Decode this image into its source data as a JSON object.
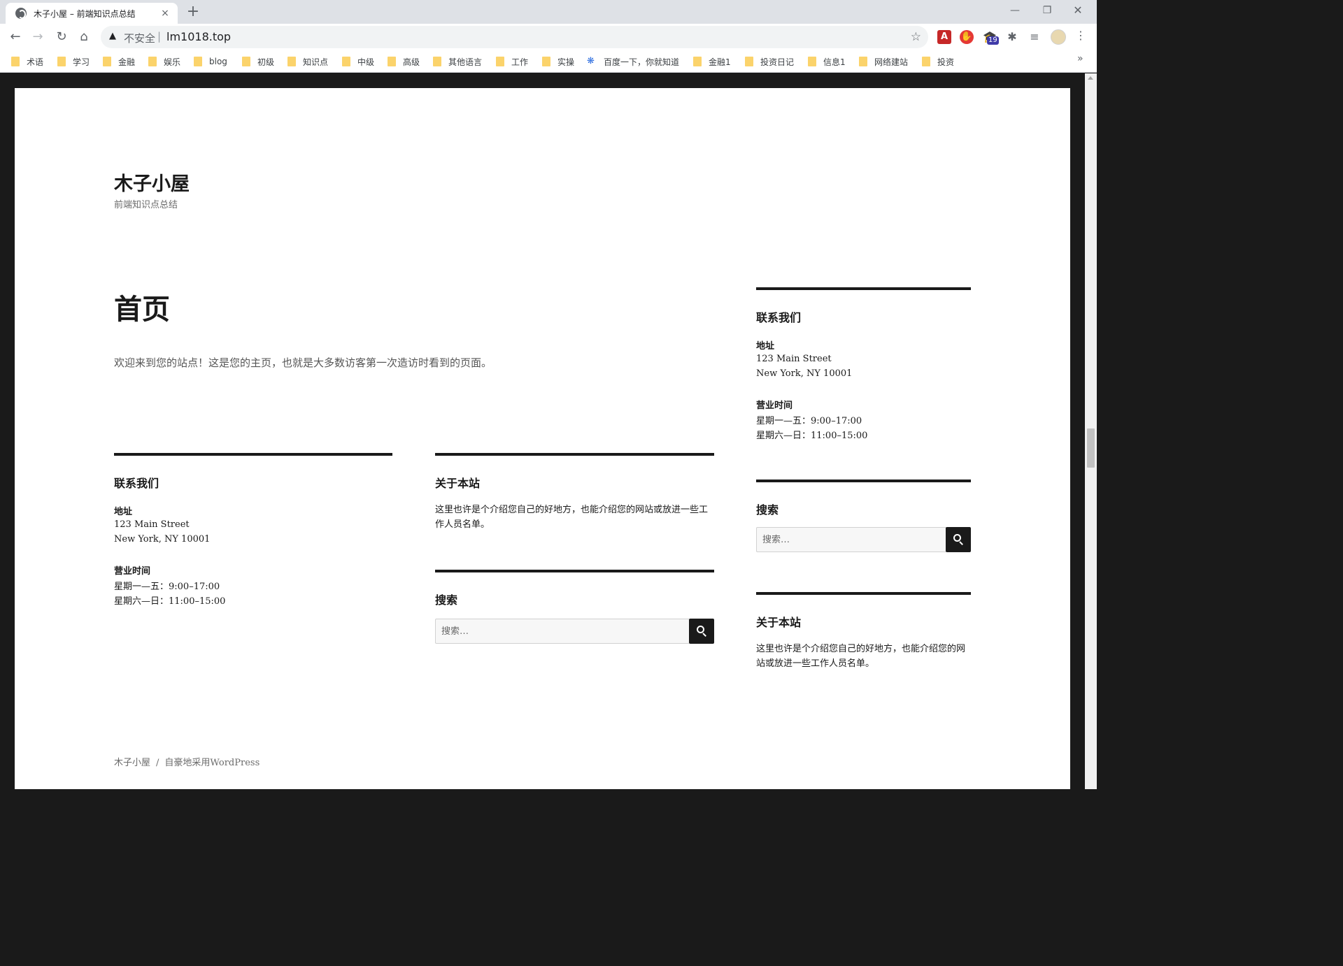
{
  "browser": {
    "tab_title": "木子小屋 – 前端知识点总结",
    "tab_close": "×",
    "new_tab": "+",
    "win_minimize": "—",
    "win_restore": "❐",
    "win_close": "✕",
    "nav": {
      "back": "←",
      "forward": "→",
      "reload": "↻",
      "home": "⌂"
    },
    "omnibox": {
      "warning_icon": "▲",
      "security_label": "不安全",
      "separator": "|",
      "url": "lm1018.top",
      "star": "☆"
    },
    "extensions": {
      "ext1": "A",
      "ext2": "✋",
      "ext3": "🎓",
      "ext3_badge": "19",
      "ext4": "✱",
      "ext5": "≡"
    },
    "menu": "⋮",
    "bookmarks": [
      {
        "label": "术语",
        "icon": "folder"
      },
      {
        "label": "学习",
        "icon": "folder"
      },
      {
        "label": "金融",
        "icon": "folder"
      },
      {
        "label": "娱乐",
        "icon": "folder"
      },
      {
        "label": "blog",
        "icon": "folder"
      },
      {
        "label": "初级",
        "icon": "folder"
      },
      {
        "label": "知识点",
        "icon": "folder"
      },
      {
        "label": "中级",
        "icon": "folder"
      },
      {
        "label": "高级",
        "icon": "folder"
      },
      {
        "label": "其他语言",
        "icon": "folder"
      },
      {
        "label": "工作",
        "icon": "folder"
      },
      {
        "label": "实操",
        "icon": "folder"
      },
      {
        "label": "百度一下，你就知道",
        "icon": "baidu-paw"
      },
      {
        "label": "金融1",
        "icon": "folder"
      },
      {
        "label": "投资日记",
        "icon": "folder"
      },
      {
        "label": "信息1",
        "icon": "folder"
      },
      {
        "label": "网络建站",
        "icon": "folder"
      },
      {
        "label": "投资",
        "icon": "folder"
      }
    ],
    "bookmarks_more": "»"
  },
  "site": {
    "title": "木子小屋",
    "description": "前端知识点总结"
  },
  "page": {
    "heading": "首页",
    "body": "欢迎来到您的站点！这是您的主页，也就是大多数访客第一次造访时看到的页面。"
  },
  "content_widgets": {
    "contact": {
      "title": "联系我们",
      "address_label": "地址",
      "address_line1": "123 Main Street",
      "address_line2": "New York, NY 10001",
      "hours_label": "营业时间",
      "hours_line1": "星期一—五：9:00–17:00",
      "hours_line2": "星期六—日：11:00–15:00"
    },
    "about": {
      "title": "关于本站",
      "text": "这里也许是个介绍您自己的好地方，也能介绍您的网站或放进一些工作人员名单。"
    },
    "search": {
      "title": "搜索",
      "placeholder": "搜索…"
    }
  },
  "sidebar": {
    "contact": {
      "title": "联系我们",
      "address_label": "地址",
      "address_line1": "123 Main Street",
      "address_line2": "New York, NY 10001",
      "hours_label": "营业时间",
      "hours_line1": "星期一—五：9:00–17:00",
      "hours_line2": "星期六—日：11:00–15:00"
    },
    "search": {
      "title": "搜索",
      "placeholder": "搜索…"
    },
    "about": {
      "title": "关于本站",
      "text": "这里也许是个介绍您自己的好地方，也能介绍您的网站或放进一些工作人员名单。"
    }
  },
  "footer": {
    "site_link": "木子小屋",
    "separator": "/",
    "powered_by": "自豪地采用WordPress"
  },
  "colors": {
    "page_background": "#1a1a1a",
    "content_background": "#ffffff",
    "accent": "#1a1a1a",
    "secondary_text": "#6a6a6a",
    "folder_icon": "#fbd36b"
  }
}
